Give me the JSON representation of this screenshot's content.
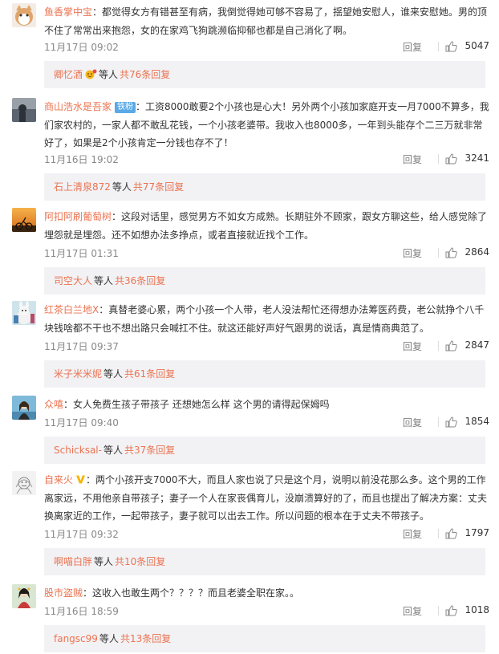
{
  "comments": [
    {
      "user": "鱼香掌中宝",
      "text": "都觉得女方有错甚至有病，我倒觉得她可够不容易了，揺望她安慰人，谁来安慰她。男的顶不住了常常出来抱怨，女的在家鸡飞狗跳濒临抑郁也都是自己消化了啊。",
      "time": "11月17日 09:02",
      "reply_label": "回复",
      "likes": "5047",
      "sub_user": "卿忆酒",
      "sub_mid": "等人",
      "sub_count": "共76条回复"
    },
    {
      "user": "商山浩水是吾家",
      "badge": "铁粉",
      "text": "工资8000敢要2个小孩也是心大！另外两个小孩加家庭开支一月7000不算多，我们家农村的，一家人都不敢乱花钱，一个小孩老婆带。我收入也8000多，一年到头能存个二三万就非常好了，如果是2个小孩肯定一分钱也存不了！",
      "time": "11月16日 19:02",
      "reply_label": "回复",
      "likes": "3241",
      "sub_user": "石上清泉872",
      "sub_mid": "等人",
      "sub_count": "共77条回复"
    },
    {
      "user": "阿扣阿刷葡萄树",
      "text": "这段对话里，感觉男方不如女方成熟。长期驻外不顾家，跟女方聊这些，给人感觉除了埋怨就是埋怨。还不如想办法多挣点，或者直接就近找个工作。",
      "time": "11月17日 01:31",
      "reply_label": "回复",
      "likes": "2864",
      "sub_user": "司空大人",
      "sub_mid": "等人",
      "sub_count": "共36条回复"
    },
    {
      "user": "红茶白兰地X",
      "text": "真替老婆心累，两个小孩一个人带，老人没法帮忙还得想办法筹医药费，老公就挣个八千块钱啥都不干也不想出路只会喊扛不住。就这还能好声好气跟男的说话，真是情商典范了。",
      "time": "11月17日 09:37",
      "reply_label": "回复",
      "likes": "2847",
      "sub_user": "米子米米妮",
      "sub_mid": "等人",
      "sub_count": "共61条回复"
    },
    {
      "user": "众嘻",
      "text": "女人免费生孩子带孩子 还想她怎么样 这个男的请得起保姆吗",
      "time": "11月17日 09:40",
      "reply_label": "回复",
      "likes": "1854",
      "sub_user": "Schicksal-",
      "sub_mid": "等人",
      "sub_count": "共37条回复"
    },
    {
      "user": "自来火",
      "verified": true,
      "text": "两个小孩开支7000不大，而且人家也说了只是这个月，说明以前没花那么多。这个男的工作离家远，不用他亲自带孩子；妻子一个人在家丧偶育儿，没崩溃算好的了，而且也提出了解决方案：丈夫换离家近的工作，一起带孩子，妻子就可以出去工作。所以问题的根本在于丈夫不带孩子。",
      "time": "11月17日 09:32",
      "reply_label": "回复",
      "likes": "1797",
      "sub_user": "啊喵白胖",
      "sub_mid": "等人",
      "sub_count": "共10条回复"
    },
    {
      "user": "股市盗贼",
      "text": "这收入也敢生两个？？？？而且老婆全职在家。。",
      "time": "11月16日 18:59",
      "reply_label": "回复",
      "likes": "1018",
      "sub_user": "fangsc99",
      "sub_mid": "等人",
      "sub_count": "共13条回复"
    }
  ],
  "colors": {
    "username": "#eb7350",
    "text": "#333333",
    "meta": "#888888",
    "sub_bg": "#f2f2f5",
    "badge_bg": "#5aa9e6",
    "verified_v": "#f8b400"
  }
}
